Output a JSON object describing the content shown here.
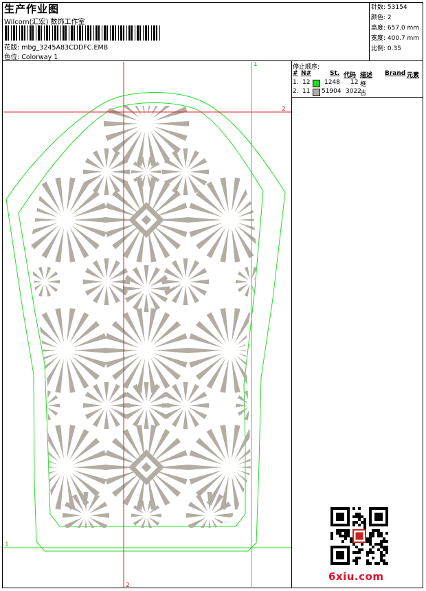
{
  "header": {
    "title": "生产作业图",
    "company": "Wilcom(汇宏) 数饰工作室",
    "design_label": "花版:",
    "design_name": "mbg_3245A83CDDFC.EMB",
    "colorway_label": "色位:",
    "colorway_name": "Colorway 1"
  },
  "stats": [
    {
      "label": "针数:",
      "value": "53154"
    },
    {
      "label": "颜色:",
      "value": "2"
    },
    {
      "label": "高度:",
      "value": "657.0 mm"
    },
    {
      "label": "宽度:",
      "value": "400.7 mm"
    },
    {
      "label": "比例:",
      "value": "0.35"
    }
  ],
  "stop_sequence": {
    "title": "停止顺序:",
    "columns": [
      "#",
      "N#",
      "St.",
      "代码",
      "描述",
      "Brand",
      "元素"
    ],
    "rows": [
      {
        "index": "1.",
        "needle": "12",
        "stitches": "1248",
        "code": "12",
        "desc": "框",
        "color": "#22dd22"
      },
      {
        "index": "2.",
        "needle": "11",
        "stitches": "51904",
        "code": "3022",
        "desc": "古",
        "color": "#b2aca2"
      }
    ]
  },
  "guides": {
    "v1_label": "1",
    "v2_label": "2",
    "h1_label": "1",
    "h2_label": "2"
  },
  "colors": {
    "frame": "#22dd22",
    "stitch": "#b2aca2",
    "guide_red": "#dd2222"
  },
  "watermark": "6xiu.com"
}
